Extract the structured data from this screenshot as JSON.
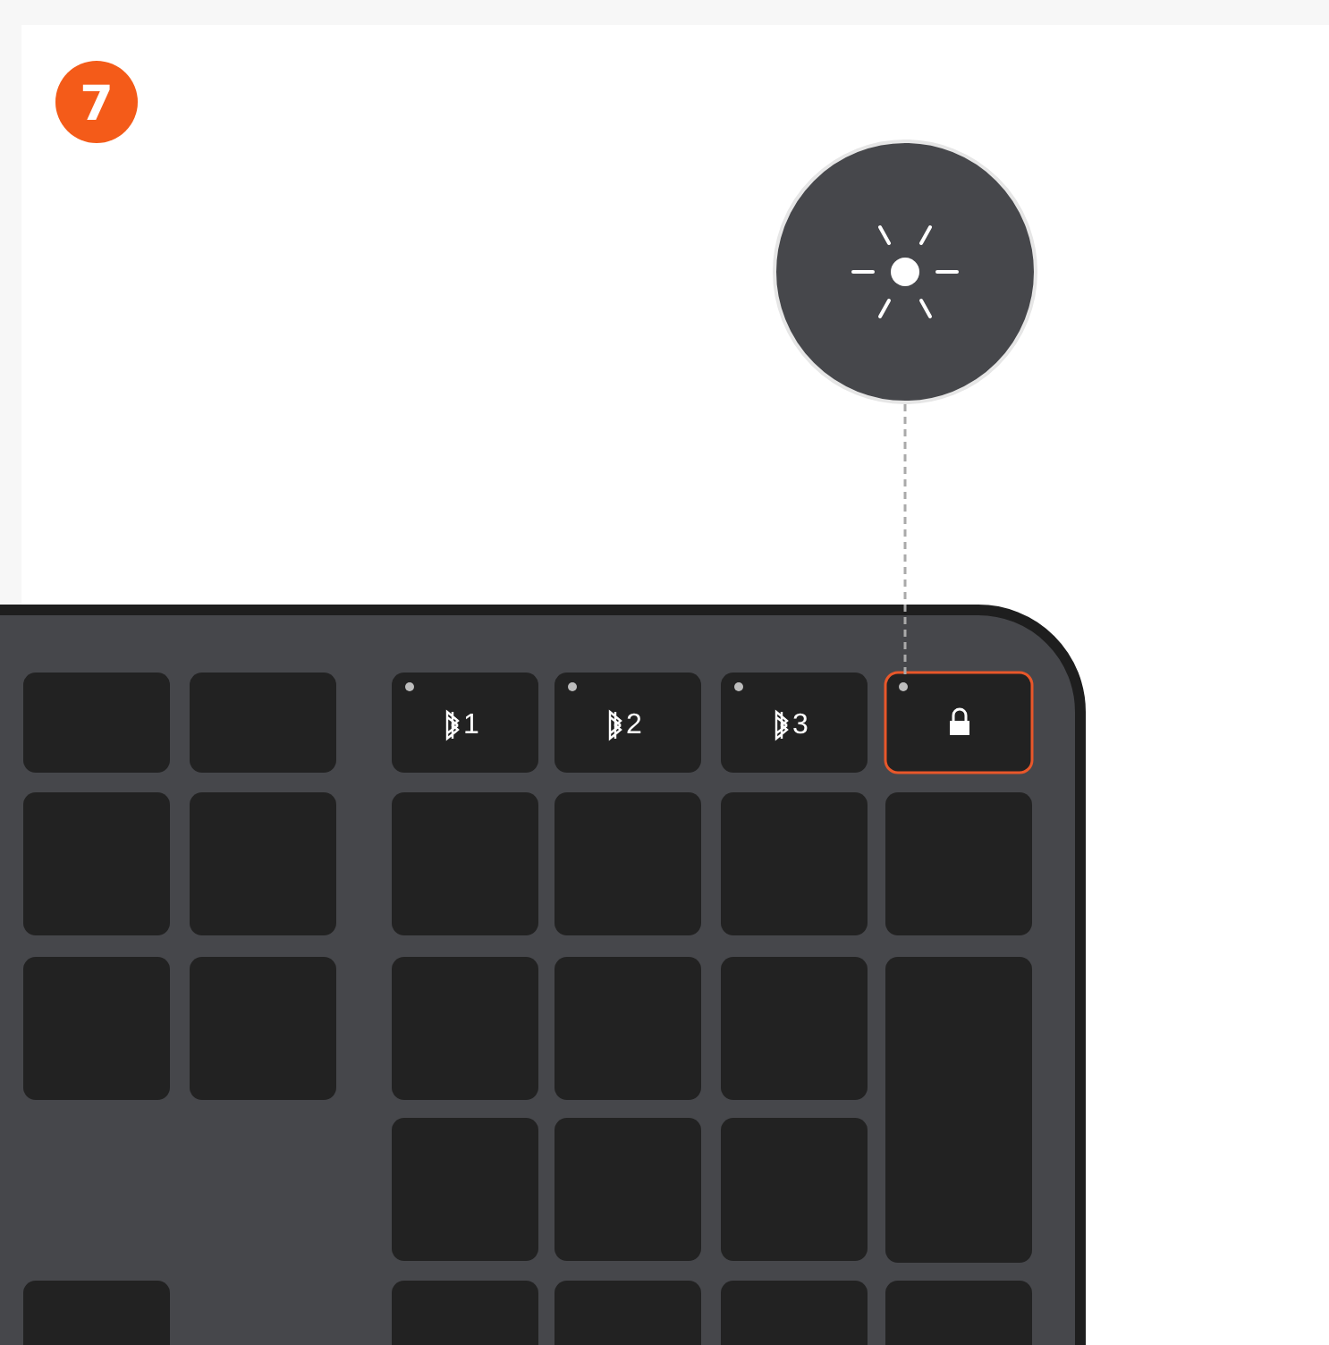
{
  "step_badge": "7",
  "top_keys": [
    {
      "kind": "bluetooth",
      "label": "1",
      "highlighted": false
    },
    {
      "kind": "bluetooth",
      "label": "2",
      "highlighted": false
    },
    {
      "kind": "bluetooth",
      "label": "3",
      "highlighted": false
    },
    {
      "kind": "lock",
      "highlighted": true
    }
  ]
}
